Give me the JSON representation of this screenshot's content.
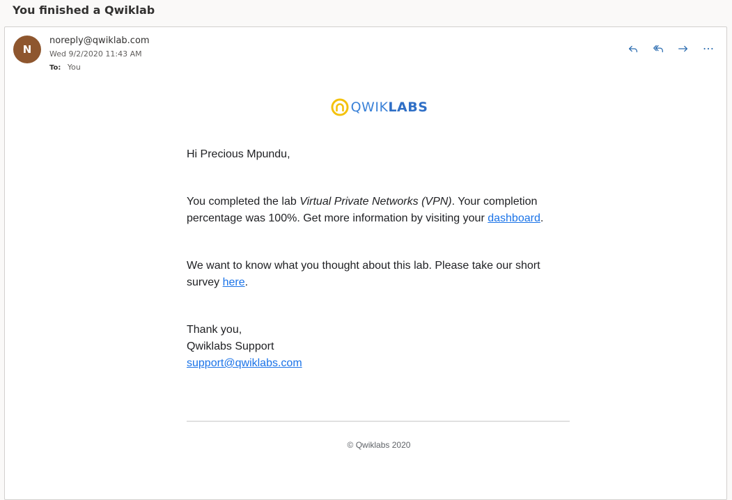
{
  "subject": "You finished a Qwiklab",
  "sender": {
    "initial": "N",
    "email": "noreply@qwiklab.com",
    "date": "Wed 9/2/2020 11:43 AM",
    "to_label": "To:",
    "to_value": "You",
    "avatar_color": "#8e562e"
  },
  "actions": [
    {
      "name": "reply",
      "icon": "reply-icon"
    },
    {
      "name": "reply-all",
      "icon": "reply-all-icon"
    },
    {
      "name": "forward",
      "icon": "forward-icon"
    },
    {
      "name": "more",
      "icon": "more-icon"
    }
  ],
  "logo": {
    "light": "QWIK",
    "bold": "LABS",
    "ring_color": "#f4c20d"
  },
  "message": {
    "greeting": "Hi Precious Mpundu,",
    "p1_before": "You completed the lab ",
    "p1_lab": "Virtual Private Networks (VPN)",
    "p1_middle": ". Your completion percentage was 100%. Get more information by visiting your ",
    "p1_link": "dashboard",
    "p1_end": ".",
    "p2_before": "We want to know what you thought about this lab. Please take our short survey ",
    "p2_link": "here",
    "p2_end": ".",
    "thanks": "Thank you,",
    "team": "Qwiklabs Support",
    "support_email": "support@qwiklabs.com",
    "link_color": "#1a73e8"
  },
  "footer": "© Qwiklabs 2020"
}
